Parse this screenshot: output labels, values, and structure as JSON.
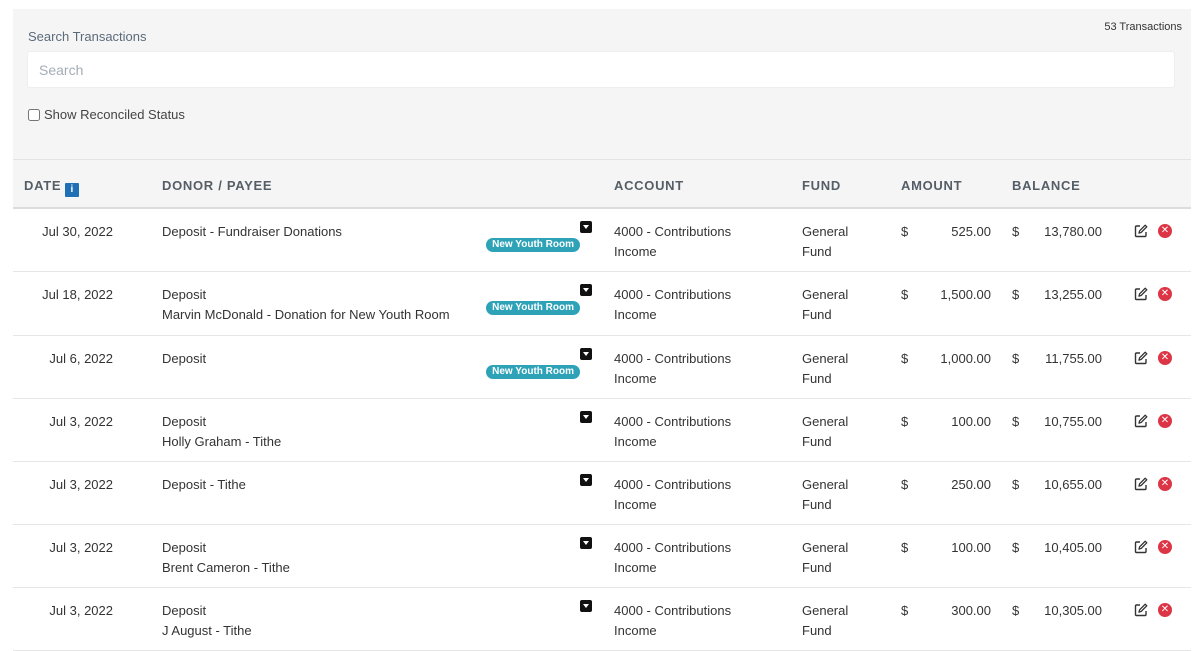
{
  "header": {
    "transaction_count": "53 Transactions",
    "search_label": "Search Transactions",
    "search_placeholder": "Search",
    "search_value": "",
    "reconciled_label": "Show Reconciled Status"
  },
  "columns": {
    "date": "DATE",
    "payee": "DONOR / PAYEE",
    "account": "ACCOUNT",
    "fund": "FUND",
    "amount": "AMOUNT",
    "balance": "BALANCE"
  },
  "currency_symbol": "$",
  "tag_color": "#2ea3b8",
  "rows": [
    {
      "date": "Jul 30, 2022",
      "payee": "Deposit - Fundraiser Donations",
      "memo": "",
      "tag": "New Youth Room",
      "account_line1": "4000 - Contributions",
      "account_line2": "Income",
      "fund_line1": "General",
      "fund_line2": "Fund",
      "amount": "525.00",
      "balance": "13,780.00"
    },
    {
      "date": "Jul 18, 2022",
      "payee": "Deposit",
      "memo": "Marvin McDonald - Donation for New Youth Room",
      "tag": "New Youth Room",
      "account_line1": "4000 - Contributions",
      "account_line2": "Income",
      "fund_line1": "General",
      "fund_line2": "Fund",
      "amount": "1,500.00",
      "balance": "13,255.00"
    },
    {
      "date": "Jul 6, 2022",
      "payee": "Deposit",
      "memo": "",
      "tag": "New Youth Room",
      "account_line1": "4000 - Contributions",
      "account_line2": "Income",
      "fund_line1": "General",
      "fund_line2": "Fund",
      "amount": "1,000.00",
      "balance": "11,755.00"
    },
    {
      "date": "Jul 3, 2022",
      "payee": "Deposit",
      "memo": "Holly Graham - Tithe",
      "tag": "",
      "account_line1": "4000 - Contributions",
      "account_line2": "Income",
      "fund_line1": "General",
      "fund_line2": "Fund",
      "amount": "100.00",
      "balance": "10,755.00"
    },
    {
      "date": "Jul 3, 2022",
      "payee": "Deposit - Tithe",
      "memo": "",
      "tag": "",
      "account_line1": "4000 - Contributions",
      "account_line2": "Income",
      "fund_line1": "General",
      "fund_line2": "Fund",
      "amount": "250.00",
      "balance": "10,655.00"
    },
    {
      "date": "Jul 3, 2022",
      "payee": "Deposit",
      "memo": "Brent Cameron - Tithe",
      "tag": "",
      "account_line1": "4000 - Contributions",
      "account_line2": "Income",
      "fund_line1": "General",
      "fund_line2": "Fund",
      "amount": "100.00",
      "balance": "10,405.00"
    },
    {
      "date": "Jul 3, 2022",
      "payee": "Deposit",
      "memo": "J August - Tithe",
      "tag": "",
      "account_line1": "4000 - Contributions",
      "account_line2": "Income",
      "fund_line1": "General",
      "fund_line2": "Fund",
      "amount": "300.00",
      "balance": "10,305.00"
    }
  ]
}
